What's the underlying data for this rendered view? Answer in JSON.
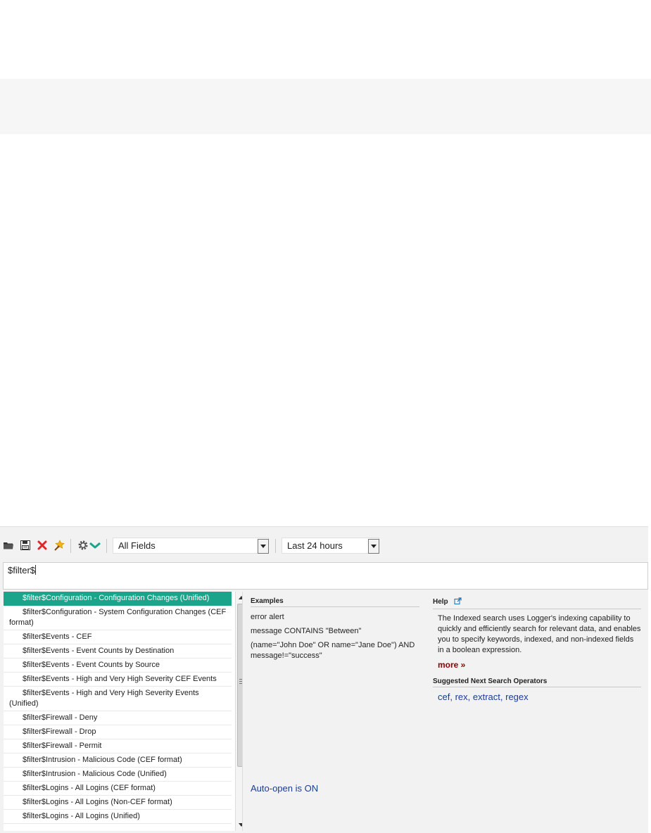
{
  "toolbar": {
    "icons": [
      "open-folder-icon",
      "save-icon",
      "delete-icon",
      "magic-wand-icon",
      "gear-icon",
      "chevron-down-icon"
    ],
    "field_select": "All Fields",
    "time_select": "Last 24 hours"
  },
  "query": {
    "value": "$filter$"
  },
  "filter_list": {
    "items": [
      "$filter$Configuration - Configuration Changes (Unified)",
      "$filter$Configuration - System Configuration Changes (CEF format)",
      "$filter$Events - CEF",
      "$filter$Events - Event Counts by Destination",
      "$filter$Events - Event Counts by Source",
      "$filter$Events - High and Very High Severity CEF Events",
      "$filter$Events - High and Very High Severity Events (Unified)",
      "$filter$Firewall - Deny",
      "$filter$Firewall - Drop",
      "$filter$Firewall - Permit",
      "$filter$Intrusion - Malicious Code (CEF format)",
      "$filter$Intrusion - Malicious Code (Unified)",
      "$filter$Logins - All Logins (CEF format)",
      "$filter$Logins - All Logins (Non-CEF format)",
      "$filter$Logins - All Logins (Unified)"
    ],
    "selected_index": 0
  },
  "examples": {
    "title": "Examples",
    "lines": [
      "error alert",
      "message CONTAINS \"Between\"",
      "(name=\"John Doe\" OR name=\"Jane Doe\") AND message!=\"success\""
    ]
  },
  "help": {
    "title": "Help",
    "text": "The Indexed search uses Logger's indexing capability to quickly and efficiently search for relevant data, and enables you to specify keywords, indexed, and non-indexed fields in a boolean expression.",
    "more": "more »",
    "suggest_title": "Suggested Next Search Operators",
    "operators": [
      "cef",
      "rex",
      "extract",
      "regex"
    ]
  },
  "status": {
    "auto_open": "Auto-open is ON"
  },
  "colors": {
    "selected_row": "#1aa58a",
    "link": "#1a3d8f",
    "more_link": "#8b0000"
  }
}
